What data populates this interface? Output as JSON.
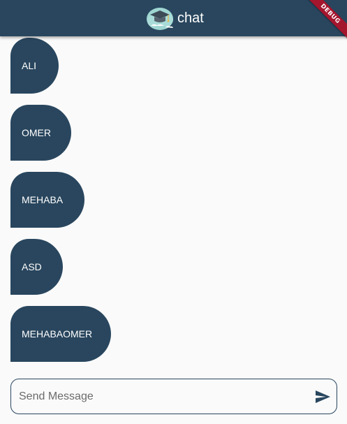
{
  "appbar": {
    "title": "chat",
    "logo_icon": "graduation-cap-cloud-icon",
    "background": "#29465e"
  },
  "debug_banner": {
    "label": "DEBUG",
    "color": "#a4152e"
  },
  "messages": [
    {
      "text": "ALI"
    },
    {
      "text": "OMER"
    },
    {
      "text": "MEHABA"
    },
    {
      "text": "ASD"
    },
    {
      "text": "MEHABAOMER"
    }
  ],
  "composer": {
    "placeholder": "Send Message",
    "value": "",
    "send_icon": "send-icon"
  },
  "colors": {
    "bubble": "#29465e",
    "background": "#fafafa",
    "text_on_bubble": "#ffffff"
  }
}
